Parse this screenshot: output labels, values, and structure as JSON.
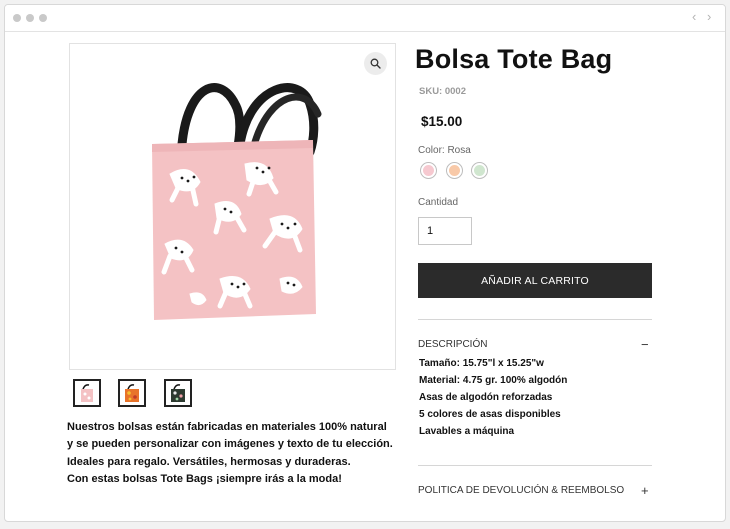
{
  "browser": {
    "back_arrow": "‹",
    "forward_arrow": "›"
  },
  "product": {
    "title": "Bolsa Tote Bag",
    "sku": "SKU: 0002",
    "price": "$15.00",
    "color_label": "Color: Rosa",
    "swatches": [
      {
        "name": "Rosa",
        "color": "#f6c9d0"
      },
      {
        "name": "Durazno",
        "color": "#f8c9a8"
      },
      {
        "name": "Verde",
        "color": "#d0e6cf"
      }
    ],
    "quantity_label": "Cantidad",
    "quantity_value": "1",
    "add_to_cart": "AÑADIR AL CARRITO",
    "accordion": {
      "description_title": "DESCRIPCIÓN",
      "description_icon": "−",
      "specs": [
        "Tamaño: 15.75\"l x 15.25\"w",
        "Material: 4.75 gr. 100% algodón",
        "Asas de algodón reforzadas",
        "5 colores de asas disponibles",
        "Lavables a máquina"
      ],
      "return_title": "POLITICA DE DEVOLUCIÓN & REEMBOLSO",
      "return_icon": "+"
    },
    "description_lines": [
      "Nuestros bolsas están fabricadas en materiales 100% natural",
      "y se pueden personalizar con imágenes y texto de tu elección.",
      "Ideales para regalo. Versátiles, hermosas  y duraderas.",
      "Con estas bolsas Tote Bags ¡siempre irás a la moda!"
    ]
  },
  "colors": {
    "bag_pink": "#f4c2c4",
    "handle": "#1a1a1a",
    "button_bg": "#2b2b2b"
  },
  "icons": {
    "zoom": "magnifier-icon",
    "thumbnails": [
      "pink-tote-thumbnail",
      "orange-tote-thumbnail",
      "green-tote-thumbnail"
    ]
  }
}
